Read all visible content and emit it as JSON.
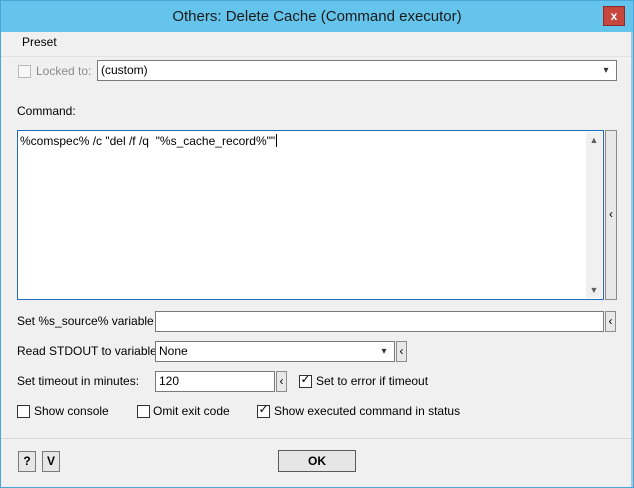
{
  "window": {
    "title": "Others: Delete Cache (Command executor)",
    "close_label": "x"
  },
  "menu": {
    "preset_label": "Preset"
  },
  "locked": {
    "label": "Locked to:",
    "checked": false,
    "select_value": "(custom)"
  },
  "command": {
    "label": "Command:",
    "value": "%comspec% /c \"del /f /q  \"%s_cache_record%\"\""
  },
  "source_var": {
    "label": "Set %s_source% variable to:",
    "value": ""
  },
  "stdout": {
    "label": "Read STDOUT to variable:",
    "select_value": "None"
  },
  "timeout": {
    "label": "Set timeout in minutes:",
    "value": "120",
    "error_label": "Set to error if timeout",
    "error_checked": true
  },
  "options": {
    "show_console_label": "Show console",
    "show_console_checked": false,
    "omit_exit_label": "Omit exit code",
    "omit_exit_checked": false,
    "show_status_label": "Show executed command in status",
    "show_status_checked": true
  },
  "footer": {
    "help_label": "?",
    "v_label": "V",
    "ok_label": "OK"
  },
  "icons": {
    "side_arrow": "‹",
    "dropdown": "▾",
    "scroll_up": "▲",
    "scroll_down": "▼",
    "check": "✓"
  }
}
